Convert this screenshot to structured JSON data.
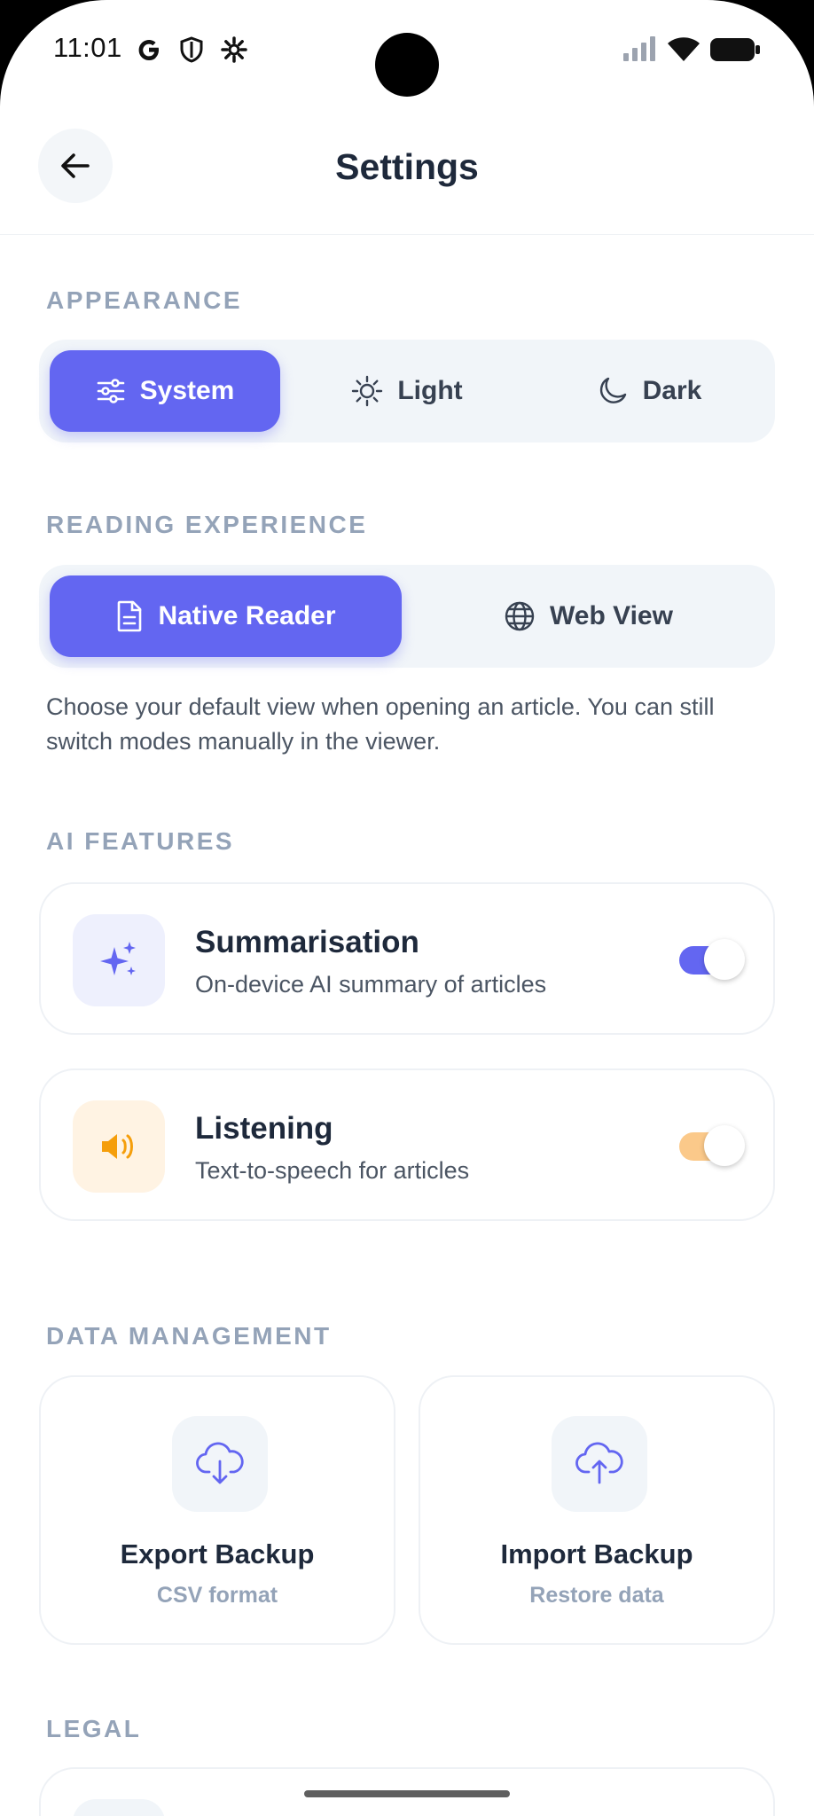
{
  "status_bar": {
    "time": "11:01",
    "icons_left": [
      "google-icon",
      "shield-icon",
      "gear-icon"
    ],
    "icons_right": [
      "signal-icon",
      "wifi-icon",
      "battery-icon"
    ]
  },
  "header": {
    "title": "Settings",
    "back_icon": "arrow-left-icon"
  },
  "appearance": {
    "label": "APPEARANCE",
    "options": [
      {
        "label": "System",
        "icon": "sliders-icon",
        "selected": true
      },
      {
        "label": "Light",
        "icon": "sun-icon",
        "selected": false
      },
      {
        "label": "Dark",
        "icon": "moon-icon",
        "selected": false
      }
    ]
  },
  "reading": {
    "label": "READING EXPERIENCE",
    "options": [
      {
        "label": "Native Reader",
        "icon": "document-icon",
        "selected": true
      },
      {
        "label": "Web View",
        "icon": "globe-icon",
        "selected": false
      }
    ],
    "helper": "Choose your default view when opening an article. You can still switch modes manually in the viewer."
  },
  "ai": {
    "label": "AI FEATURES",
    "features": [
      {
        "title": "Summarisation",
        "subtitle": "On-device AI summary of articles",
        "icon": "sparkles-icon",
        "enabled": true,
        "accent": "#6366f1"
      },
      {
        "title": "Listening",
        "subtitle": "Text-to-speech for articles",
        "icon": "speaker-icon",
        "enabled": true,
        "accent": "#f59e0b"
      }
    ]
  },
  "data": {
    "label": "DATA MANAGEMENT",
    "cards": [
      {
        "title": "Export Backup",
        "subtitle": "CSV format",
        "icon": "cloud-download-icon"
      },
      {
        "title": "Import Backup",
        "subtitle": "Restore data",
        "icon": "cloud-upload-icon"
      }
    ]
  },
  "legal": {
    "label": "LEGAL"
  },
  "colors": {
    "accent": "#6366f1",
    "orange": "#f59e0b",
    "text_primary": "#1e293b",
    "section_label": "#94a3b8"
  }
}
